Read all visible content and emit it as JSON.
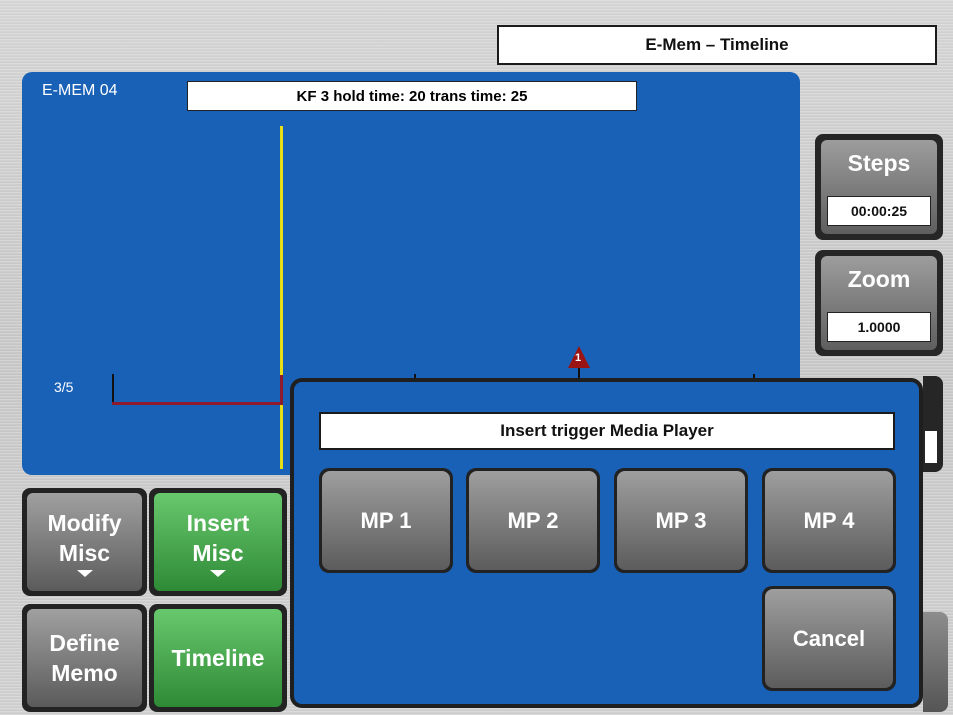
{
  "header": {
    "title": "E-Mem – Timeline"
  },
  "timeline": {
    "memory_name": "E-MEM 04",
    "keyframe_info": "KF 3 hold time: 20 trans time: 25",
    "track_label": "3/5",
    "marker_number": "1"
  },
  "side_panel": {
    "steps_label": "Steps",
    "steps_value": "00:00:25",
    "zoom_label": "Zoom",
    "zoom_value": "1.0000"
  },
  "bottom_buttons": {
    "modify_misc_line1": "Modify",
    "modify_misc_line2": "Misc",
    "insert_misc_line1": "Insert",
    "insert_misc_line2": "Misc",
    "define_memo_line1": "Define",
    "define_memo_line2": "Memo",
    "timeline": "Timeline"
  },
  "dialog": {
    "title": "Insert trigger Media Player",
    "options": [
      "MP 1",
      "MP 2",
      "MP 3",
      "MP 4"
    ],
    "cancel": "Cancel"
  },
  "colors": {
    "panel_blue": "#1961b6",
    "active_green": "#3fa046",
    "cursor_yellow": "#e6de16",
    "track_red": "#8e1a2d"
  }
}
